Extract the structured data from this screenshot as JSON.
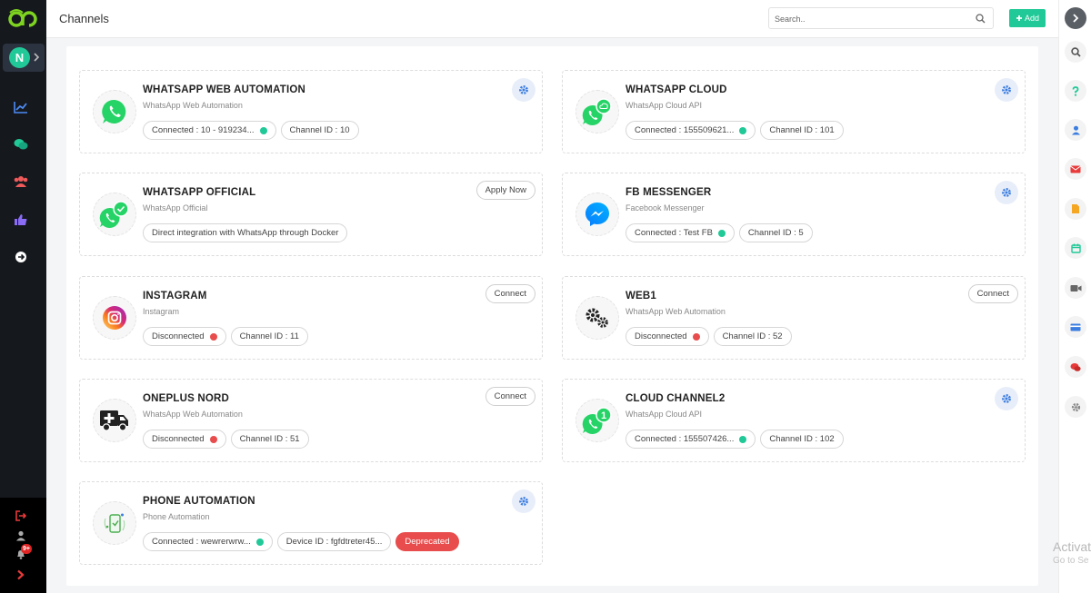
{
  "header": {
    "title": "Channels",
    "search_placeholder": "Search..",
    "add_label": "Add"
  },
  "sidebar": {
    "avatar_initial": "N",
    "notification_count": "9+"
  },
  "watermark": {
    "line1": "Activat",
    "line2": "Go to Se"
  },
  "channels": [
    {
      "title": "WHATSAPP WEB AUTOMATION",
      "subtitle": "WhatsApp Web Automation",
      "status": "Connected : 10 - 919234...",
      "channel_id": "Channel ID : 10",
      "logo_icon": "whatsapp-icon"
    },
    {
      "title": "WHATSAPP CLOUD",
      "subtitle": "WhatsApp Cloud API",
      "status": "Connected : 155509621...",
      "channel_id": "Channel ID : 101",
      "logo_icon": "whatsapp-cloud-icon"
    },
    {
      "title": "WHATSAPP OFFICIAL",
      "subtitle": "WhatsApp Official",
      "note": "Direct integration with WhatsApp through Docker",
      "action_label": "Apply Now",
      "logo_icon": "whatsapp-verified-icon"
    },
    {
      "title": "FB MESSENGER",
      "subtitle": "Facebook Messenger",
      "status": "Connected : Test FB",
      "channel_id": "Channel ID : 5",
      "logo_icon": "messenger-icon"
    },
    {
      "title": "INSTAGRAM",
      "subtitle": "Instagram",
      "status": "Disconnected",
      "channel_id": "Channel ID : 11",
      "action_label": "Connect",
      "logo_icon": "instagram-icon"
    },
    {
      "title": "WEB1",
      "subtitle": "WhatsApp Web Automation",
      "status": "Disconnected",
      "channel_id": "Channel ID : 52",
      "action_label": "Connect",
      "logo_icon": "gears-icon"
    },
    {
      "title": "ONEPLUS NORD",
      "subtitle": "WhatsApp Web Automation",
      "status": "Disconnected",
      "channel_id": "Channel ID : 51",
      "action_label": "Connect",
      "logo_icon": "ambulance-icon"
    },
    {
      "title": "CLOUD CHANNEL2",
      "subtitle": "WhatsApp Cloud API",
      "status": "Connected : 155507426...",
      "channel_id": "Channel ID : 102",
      "logo_icon": "whatsapp-numbered-icon",
      "logo_number": "1"
    },
    {
      "title": "PHONE AUTOMATION",
      "subtitle": "Phone Automation",
      "status": "Connected : wewrerwrw...",
      "device_id": "Device ID : fgfdtreter45...",
      "deprecated_label": "Deprecated",
      "logo_icon": "phone-automation-icon"
    }
  ]
}
